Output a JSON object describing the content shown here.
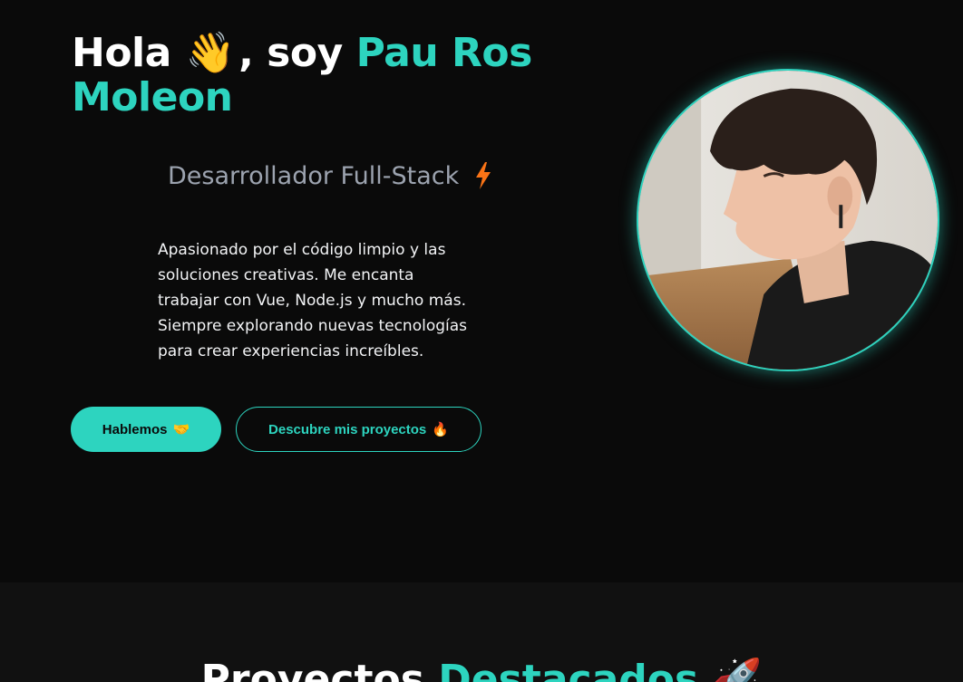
{
  "hero": {
    "greeting": "Hola",
    "wave_emoji": "👋",
    "soy": ", soy",
    "name_first": "Pau Ros",
    "name_last": "Moleon",
    "subtitle": "Desarrollador Full-Stack",
    "subtitle_icon": "lightning-bolt-icon",
    "about": "Apasionado por el código limpio y las soluciones creativas. Me encanta trabajar con Vue, Node.js y mucho más. Siempre explorando nuevas tecnologías para crear experiencias increíbles.",
    "buttons": {
      "talk_label": "Hablemos",
      "talk_emoji": "🤝",
      "projects_label": "Descubre mis proyectos",
      "projects_emoji": "🔥"
    },
    "avatar_alt": "profile-photo"
  },
  "projects": {
    "title_main": "Proyectos",
    "title_accent": "Destacados",
    "title_emoji": "🚀"
  },
  "colors": {
    "background": "#0a0a0a",
    "section_background": "#111111",
    "accent": "#2dd4bf",
    "muted_text": "#9ca3af",
    "bolt": "#f97316"
  }
}
